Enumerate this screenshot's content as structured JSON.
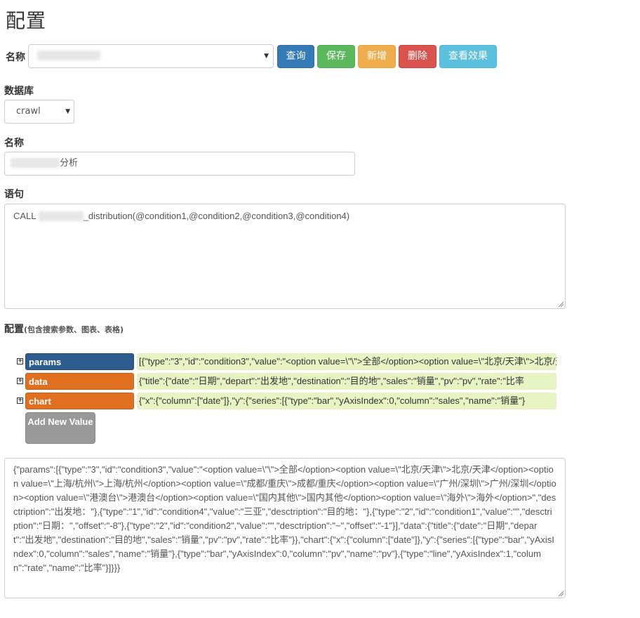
{
  "page_title": "配置",
  "top": {
    "name_label": "名称",
    "name_select_value": "",
    "buttons": {
      "query": "查询",
      "save": "保存",
      "add": "新增",
      "delete": "删除",
      "view": "查看效果"
    }
  },
  "database": {
    "label": "数据库",
    "selected": "crawl"
  },
  "name_field": {
    "label": "名称",
    "value_suffix": "分析"
  },
  "statement": {
    "label": "语句",
    "value_prefix": "CALL ",
    "value_suffix": "_distribution(@condition1,@condition2,@condition3,@condition4)"
  },
  "config": {
    "label": "配置",
    "hint": "(包含搜索参数、图表、表格)",
    "rows": [
      {
        "key": "params",
        "value": "[{\"type\":\"3\",\"id\":\"condition3\",\"value\":\"<option value=\\\"\\\">全部</option><option value=\\\"北京/天津\\\">北京/天津"
      },
      {
        "key": "data",
        "value": "{\"title\":{\"date\":\"日期\",\"depart\":\"出发地\",\"destination\":\"目的地\",\"sales\":\"销量\",\"pv\":\"pv\",\"rate\":\"比率"
      },
      {
        "key": "chart",
        "value": "{\"x\":{\"column\":[\"date\"]},\"y\":{\"series\":[{\"type\":\"bar\",\"yAxisIndex\":0,\"column\":\"sales\",\"name\":\"销量\"}"
      }
    ],
    "add_new_label": "Add New Value",
    "json_text": "{\"params\":[{\"type\":\"3\",\"id\":\"condition3\",\"value\":\"<option value=\\\"\\\">全部</option><option value=\\\"北京/天津\\\">北京/天津</option><option value=\\\"上海/杭州\\\">上海/杭州</option><option value=\\\"成都/重庆\\\">成都/重庆</option><option value=\\\"广州/深圳\\\">广州/深圳</option><option value=\\\"港澳台\\\">港澳台</option><option value=\\\"国内其他\\\">国内其他</option><option value=\\\"海外\\\">海外</option>\",\"desctription\":\"出发地：\"},{\"type\":\"1\",\"id\":\"condition4\",\"value\":\"三亚\",\"desctription\":\"目的地：\"},{\"type\":\"2\",\"id\":\"condition1\",\"value\":\"\",\"desctription\":\"日期：\",\"offset\":\"-8\"},{\"type\":\"2\",\"id\":\"condition2\",\"value\":\"\",\"desctription\":\"~\",\"offset\":\"-1\"}],\"data\":{\"title\":{\"date\":\"日期\",\"depart\":\"出发地\",\"destination\":\"目的地\",\"sales\":\"销量\",\"pv\":\"pv\",\"rate\":\"比率\"}},\"chart\":{\"x\":{\"column\":[\"date\"]},\"y\":{\"series\":[{\"type\":\"bar\",\"yAxisIndex\":0,\"column\":\"sales\",\"name\":\"销量\"},{\"type\":\"bar\",\"yAxisIndex\":0,\"column\":\"pv\",\"name\":\"pv\"},{\"type\":\"line\",\"yAxisIndex\":1,\"column\":\"rate\",\"name\":\"比率\"}]}}}"
  }
}
